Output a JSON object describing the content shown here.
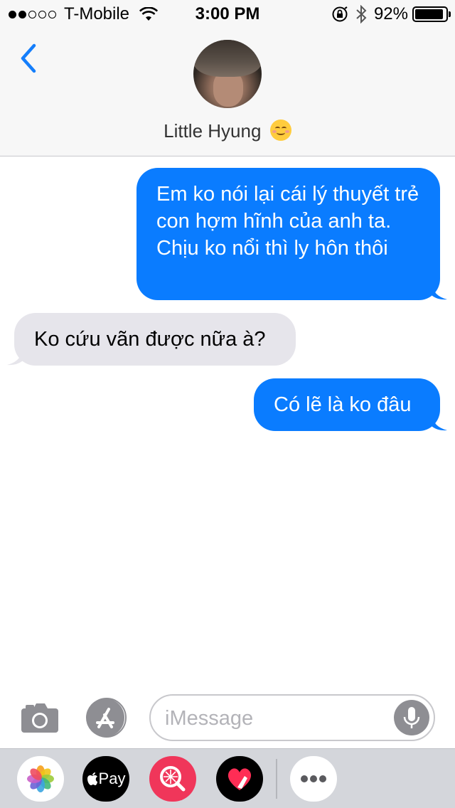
{
  "status_bar": {
    "carrier": "T-Mobile",
    "time": "3:00 PM",
    "battery": "92%",
    "battery_level": 0.92,
    "signal_bars": 2,
    "icons": [
      "signal-dots-icon",
      "wifi-icon",
      "rotation-lock-icon",
      "bluetooth-icon",
      "battery-icon"
    ]
  },
  "header": {
    "contact_name": "Little Hyung",
    "contact_emoji": "☺️",
    "back_icon": "chevron-left-icon"
  },
  "messages": [
    {
      "direction": "sent",
      "text": "Em ko nói lại cái lý thuyết trẻ con hợm hĩnh của anh ta. Chịu ko nổi thì ly hôn thôi"
    },
    {
      "direction": "received",
      "text": "Ko cứu vãn được nữa à?"
    },
    {
      "direction": "sent",
      "text": "Có lẽ là ko đâu"
    }
  ],
  "input_bar": {
    "placeholder": "iMessage",
    "value": "",
    "icons": [
      "camera-icon",
      "app-store-icon",
      "microphone-icon"
    ]
  },
  "app_tray": {
    "apple_pay_label": "Pay",
    "apps": [
      "photos-app-icon",
      "apple-pay-app-icon",
      "search-images-app-icon",
      "digital-touch-app-icon",
      "more-apps-icon"
    ]
  },
  "colors": {
    "sent_bubble": "#0a7cff",
    "received_bubble": "#e6e5eb",
    "accent": "#147efb",
    "header_bg": "#f7f7f7",
    "tray_bg": "#d4d6db"
  }
}
